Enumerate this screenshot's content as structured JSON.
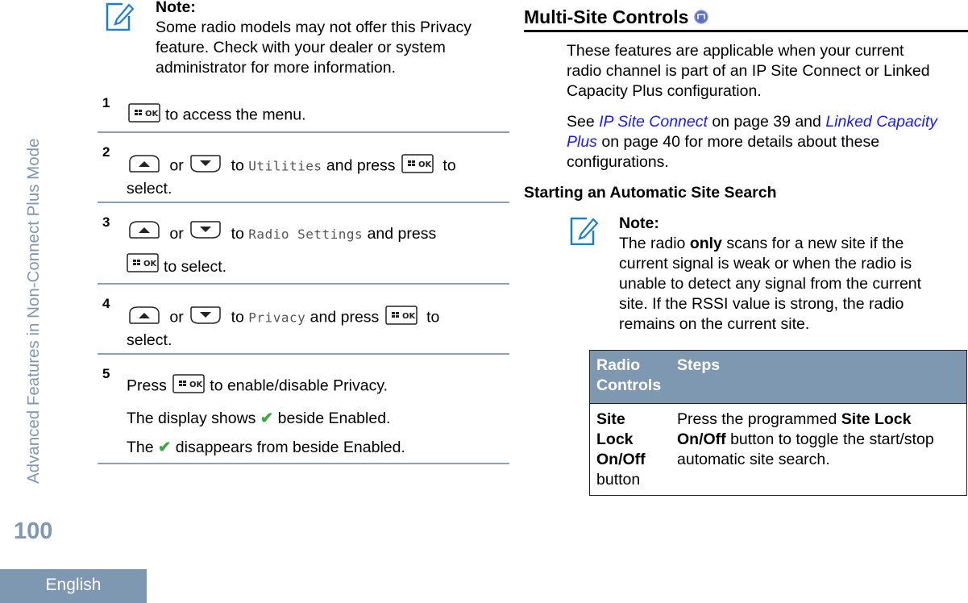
{
  "sidebar": {
    "section_title": "Advanced Features in Non-Connect Plus Mode",
    "page_number": "100",
    "language_tab": "English"
  },
  "left_column": {
    "note": {
      "label": "Note:",
      "lines": [
        "Some radio models may not offer this Privacy",
        "feature. Check with your dealer or system",
        "administrator for more information."
      ]
    },
    "steps": [
      {
        "number": "1",
        "text_after_key": "to access the menu."
      },
      {
        "number": "2",
        "or": "or",
        "to": "to",
        "menu_item": "Utilities",
        "and_press": "and press",
        "to_end": "to",
        "line2": "select."
      },
      {
        "number": "3",
        "or": "or",
        "to": "to",
        "menu_item": "Radio Settings",
        "and_press": "and press",
        "line2": "to select."
      },
      {
        "number": "4",
        "or": "or",
        "to": "to",
        "menu_item": "Privacy",
        "and_press": "and press",
        "to_end": "to",
        "line2": "select."
      },
      {
        "number": "5",
        "press": "Press",
        "text_after_key": "to enable/disable Privacy.",
        "result1_pre": "The display shows",
        "result1_post": "beside Enabled.",
        "result2_pre": "The",
        "result2_post": "disappears from beside Enabled."
      }
    ],
    "keys": {
      "ok": "OK",
      "up": "up-arrow",
      "down": "down-arrow"
    }
  },
  "right_column": {
    "heading": "Multi-Site Controls",
    "heading_icon": "feature-badge-icon",
    "intro_lines": [
      "These features are applicable when your current",
      "radio channel is part of an IP Site Connect or Linked",
      "Capacity Plus configuration."
    ],
    "see": {
      "pre": "See",
      "link1": "IP Site Connect",
      "mid": "on page 39 and",
      "link2_part1": "Linked Capacity",
      "link2_part2": "Plus",
      "post": "on page 40 for more details about these",
      "line3": "configurations."
    },
    "subheading": "Starting an Automatic Site Search",
    "note": {
      "label": "Note:",
      "line1_pre": "The radio",
      "line1_bold": "only",
      "line1_post": "scans for a new site if the",
      "lines": [
        "current signal is weak or when the radio is",
        "unable to detect any signal from the current",
        "site. If the RSSI value is strong, the radio",
        "remains on the current site."
      ]
    },
    "table": {
      "headers": [
        "Radio Controls",
        "Steps"
      ],
      "header_col1_lines": [
        "Radio",
        "Controls"
      ],
      "rows": [
        {
          "control_bold_lines": [
            "Site",
            "Lock",
            "On/Off"
          ],
          "control_tail": "button",
          "steps_pre": "Press the programmed",
          "steps_bold1": "Site Lock",
          "steps_bold2": "On/Off",
          "steps_post": "button to toggle the start/stop",
          "steps_line3": "automatic site search."
        }
      ]
    }
  },
  "colors": {
    "accent": "#7f98b2",
    "link": "#1a1aff",
    "check": "#3aa83a",
    "note_icon": "#1a7fd0"
  }
}
